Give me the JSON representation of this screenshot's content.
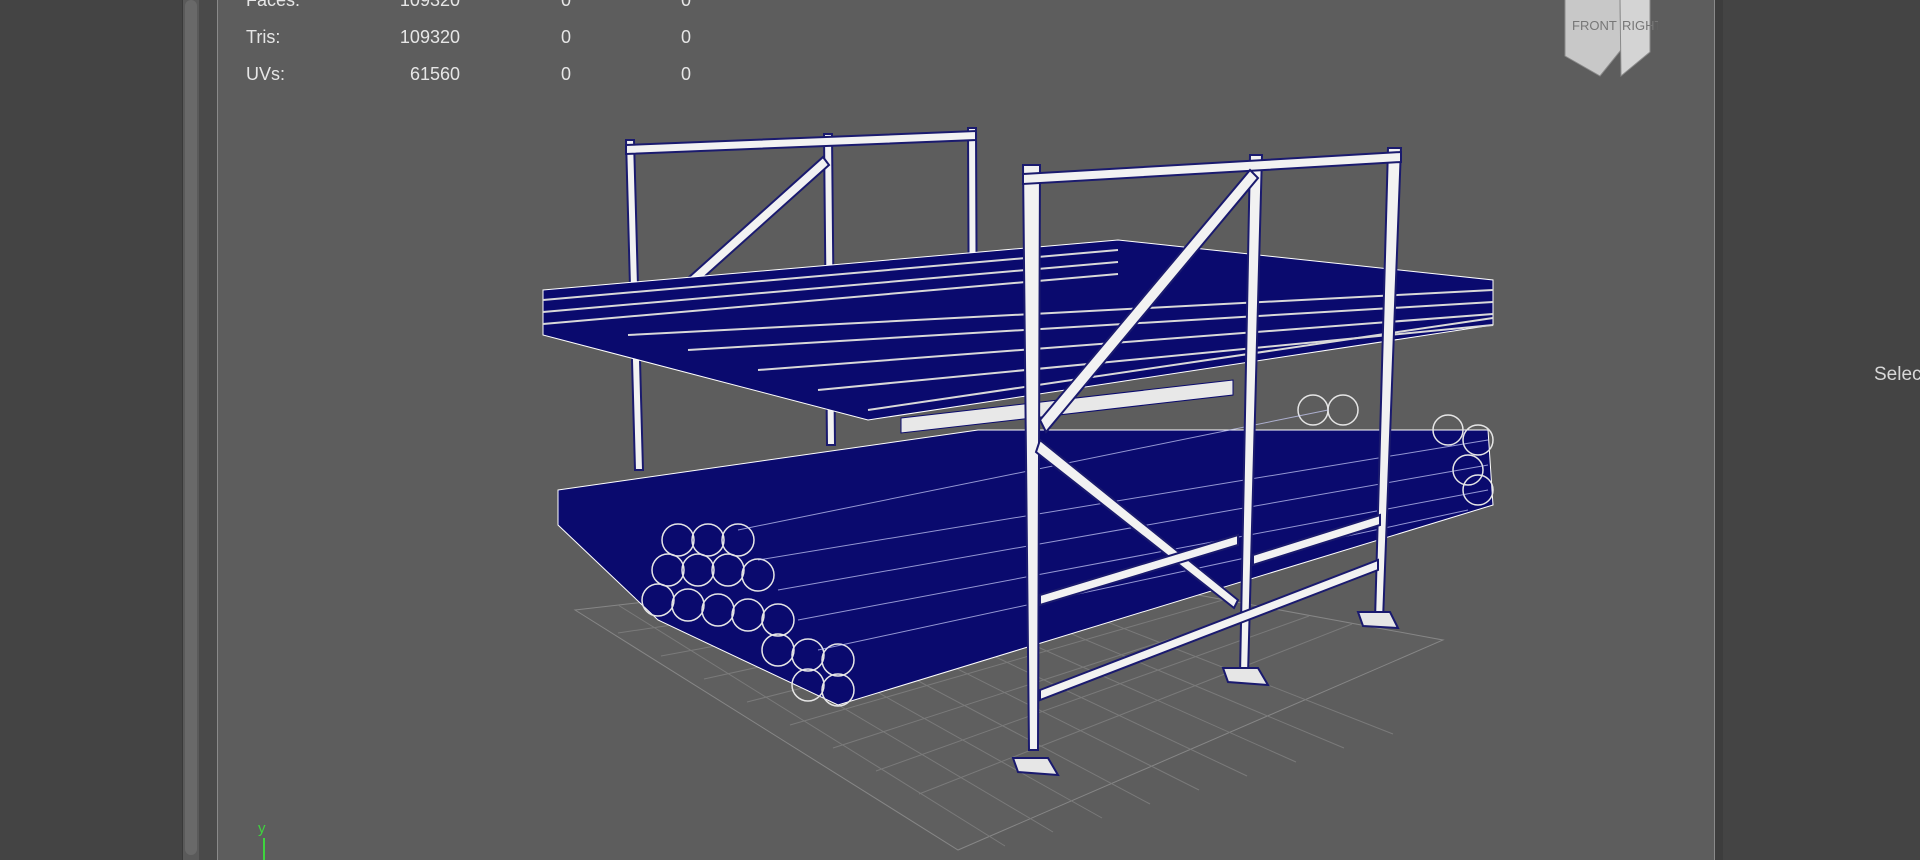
{
  "hud": {
    "rows": [
      {
        "label": "Faces:",
        "v1": "109320",
        "v2": "0",
        "v3": "0"
      },
      {
        "label": "Tris:",
        "v1": "109320",
        "v2": "0",
        "v3": "0"
      },
      {
        "label": "UVs:",
        "v1": "61560",
        "v2": "0",
        "v3": "0"
      }
    ]
  },
  "view_cube": {
    "front": "FRONT",
    "right": "RIGHT"
  },
  "axis": {
    "label": "y"
  },
  "right_panel": {
    "text": "Selec"
  },
  "colors": {
    "wireframe": "#0a0a6e",
    "frame": "#ffffff",
    "viewport_bg": "#5d5d5d",
    "grid": "#7a7a7a",
    "axis": "#3ed43e"
  }
}
